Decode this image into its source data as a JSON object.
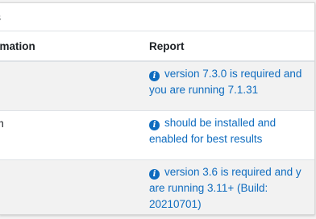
{
  "header": {
    "title": "s"
  },
  "table": {
    "columns": {
      "information": "ormation",
      "report": "Report"
    },
    "rows": [
      {
        "information": "",
        "icon": "info-circle-icon",
        "report": "version 7.3.0 is required and you are running 7.1.31"
      },
      {
        "information": "um",
        "icon": "info-circle-icon",
        "report": "should be installed and enabled for best results"
      },
      {
        "information": "",
        "icon": "info-circle-icon",
        "report": "version 3.6 is required and y are running 3.11+ (Build: 20210701)"
      }
    ]
  },
  "colors": {
    "link": "#0f6cbf",
    "striped_row": "#f2f2f2",
    "border": "#dee2e6"
  }
}
